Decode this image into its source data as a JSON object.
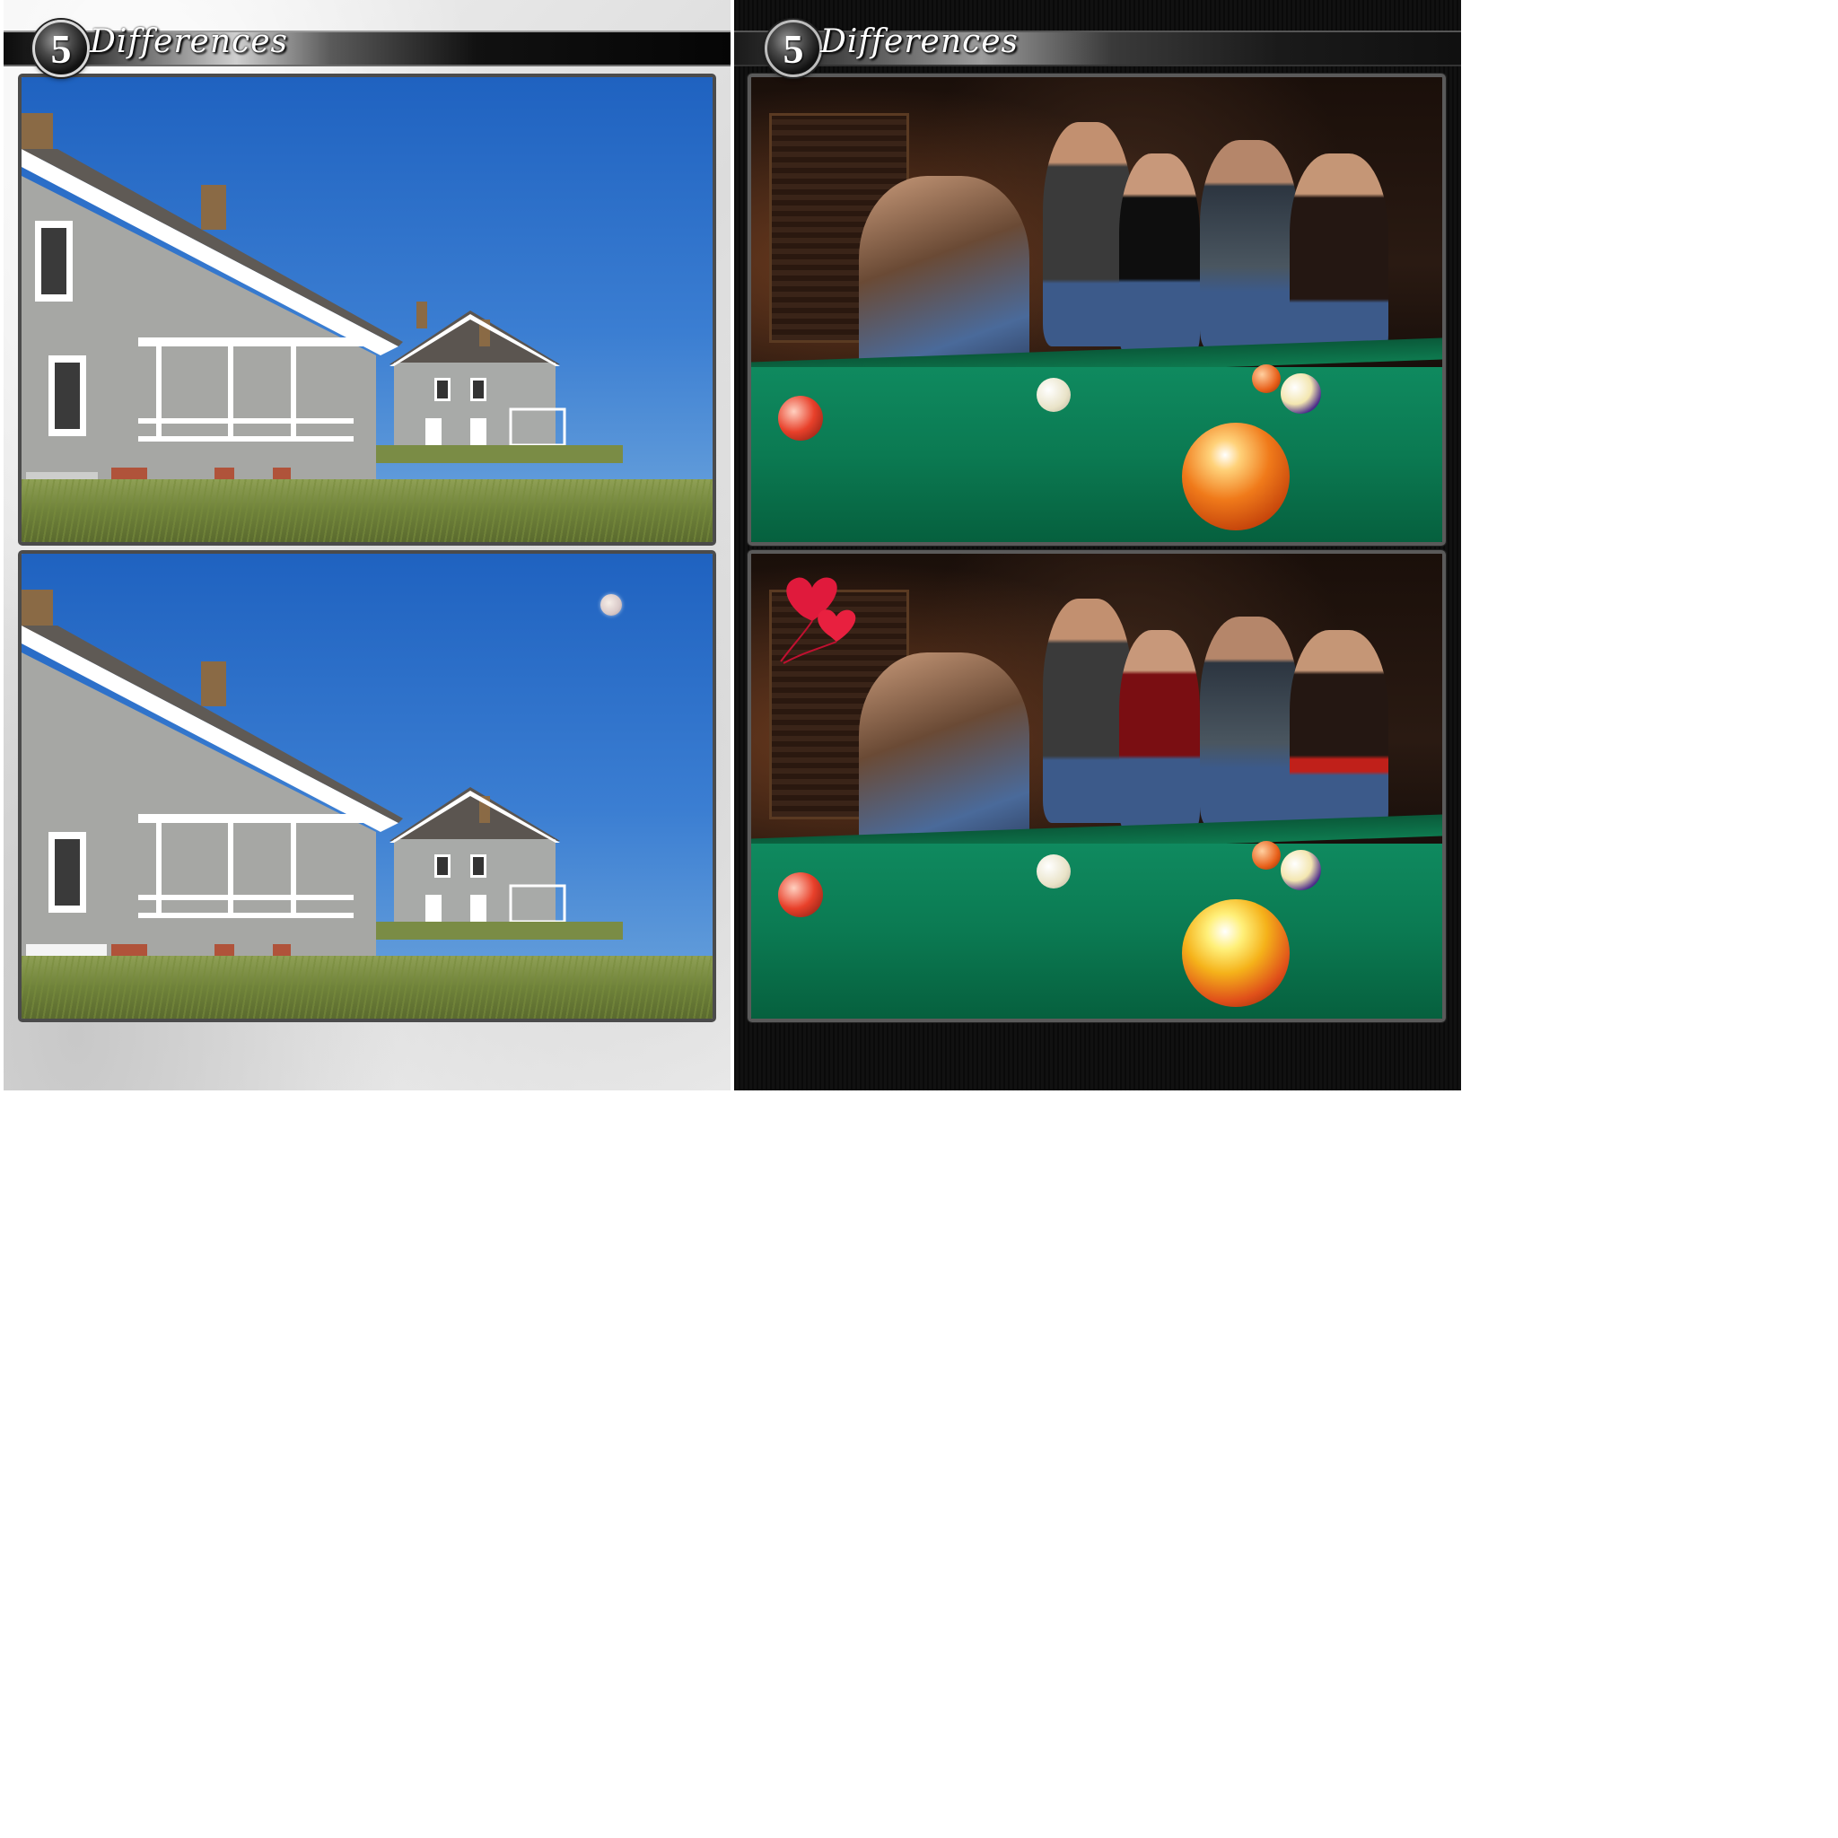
{
  "panels": [
    {
      "id": "houses",
      "badge_number": "5",
      "title": "Differences",
      "scene": "houses-by-sea"
    },
    {
      "id": "pool",
      "badge_number": "5",
      "title": "Differences",
      "scene": "billiards-bar"
    }
  ],
  "colors": {
    "sky": "#2f6fc9",
    "grass": "#7a8c45",
    "felt": "#0b7a52",
    "bar_dark": "#120b08",
    "title_text": "#ffffff"
  },
  "icons": {
    "badge": "number-badge-icon",
    "moon": "moon-icon",
    "balloons": "heart-balloons-icon"
  }
}
